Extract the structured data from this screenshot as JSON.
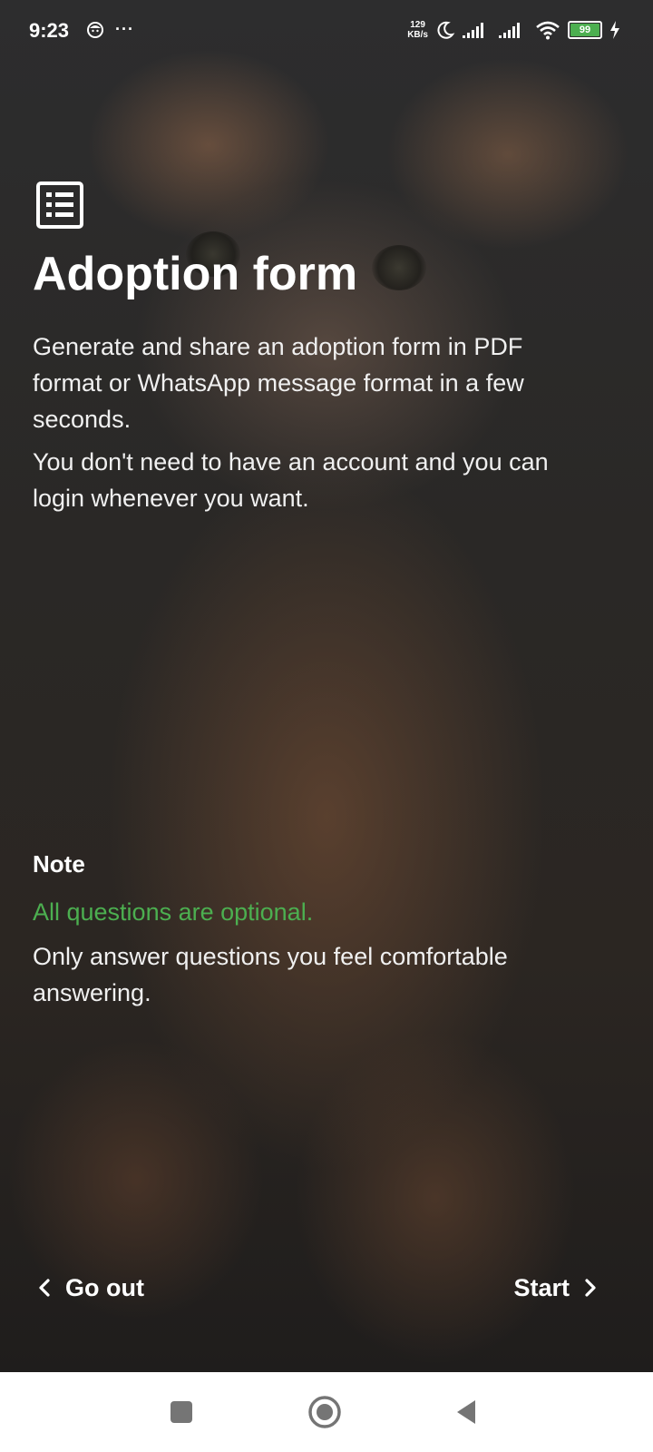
{
  "status_bar": {
    "time": "9:23",
    "more_dots": "···",
    "net_speed_value": "129",
    "net_speed_unit": "KB/s",
    "battery_level": "99",
    "battery_color": "#4CAF50"
  },
  "screen": {
    "icon": "form-list-icon",
    "title": "Adoption form",
    "description": "Generate and share an adoption form in PDF format or WhatsApp message format in a few seconds.",
    "description_2": "You don't need to have an account and you can login whenever you want.",
    "note_label": "Note",
    "note_highlight": "All questions are optional.",
    "note_text": "Only answer questions you feel comfortable answering.",
    "highlight_color": "#4CAF50"
  },
  "actions": {
    "go_out_label": "Go out",
    "start_label": "Start"
  },
  "system_nav": {
    "recents_icon": "square-icon",
    "home_icon": "circle-icon",
    "back_icon": "triangle-back-icon"
  }
}
